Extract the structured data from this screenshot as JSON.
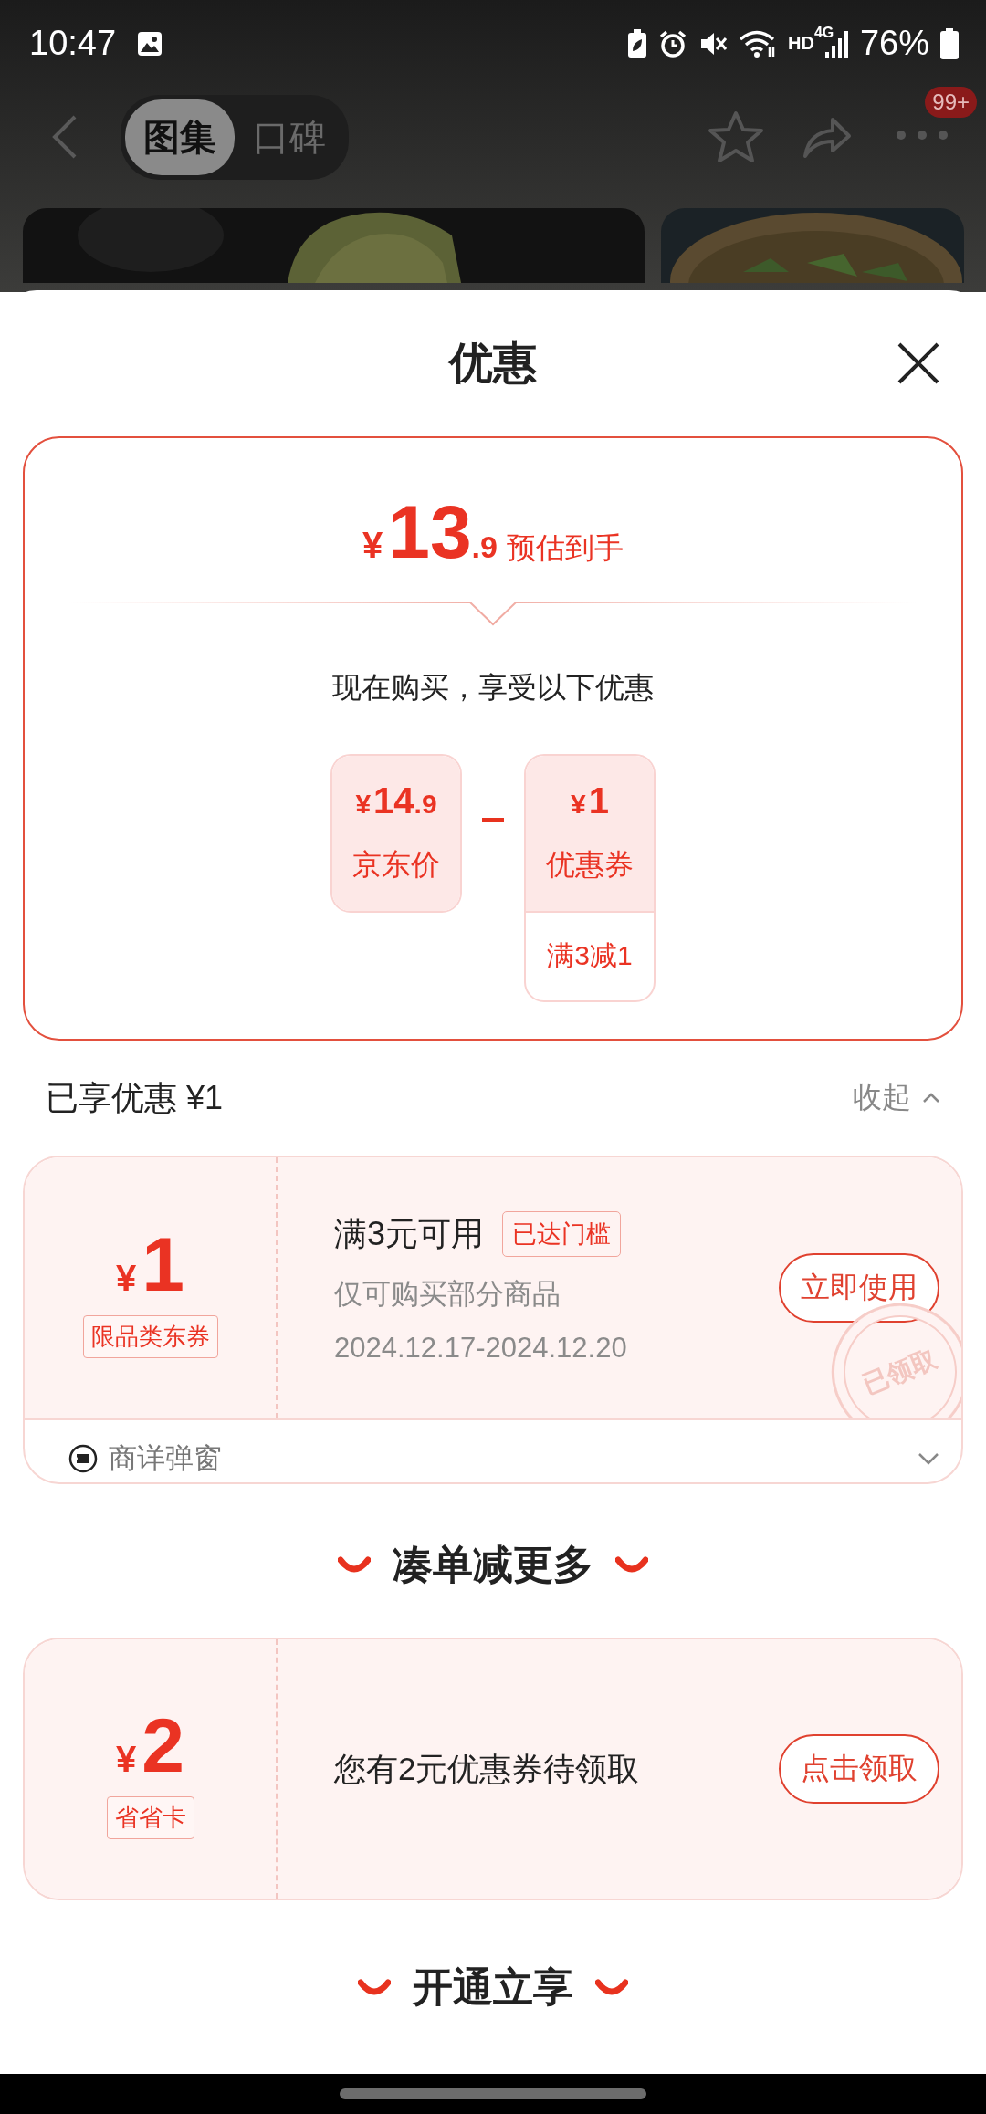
{
  "status_bar": {
    "time": "10:47",
    "hd": "HD",
    "network": "4G",
    "battery": "76%"
  },
  "nav": {
    "tabs": [
      {
        "label": "图集",
        "selected": true
      },
      {
        "label": "口碑",
        "selected": false
      }
    ],
    "badge": "99+"
  },
  "sheet": {
    "title": "优惠"
  },
  "estimate": {
    "currency": "¥",
    "integer": "13",
    "decimal": ".9",
    "label": "预估到手",
    "intro": "现在购买，享受以下优惠",
    "terms": [
      {
        "currency": "¥",
        "integer": "14",
        "decimal": ".9",
        "label": "京东价"
      },
      {
        "currency": "¥",
        "integer": "1",
        "label": "优惠券",
        "condition": "满3减1"
      }
    ]
  },
  "applied": {
    "title": "已享优惠 ¥1",
    "toggle": "收起",
    "expanded": true,
    "coupons": [
      {
        "currency": "¥",
        "amount": "1",
        "tag": "限品类东券",
        "condition": "满3元可用",
        "badge": "已达门槛",
        "scope": "仅可购买部分商品",
        "validity": "2024.12.17-2024.12.20",
        "button": "立即使用",
        "stamp": "已领取",
        "source": "商详弹窗",
        "source_expanded": false
      }
    ]
  },
  "more": {
    "title": "凑单减更多",
    "offers": [
      {
        "currency": "¥",
        "amount": "2",
        "tag": "省省卡",
        "text": "您有2元优惠券待领取",
        "button": "点击领取"
      }
    ]
  },
  "footer_section": {
    "title": "开通立享"
  }
}
